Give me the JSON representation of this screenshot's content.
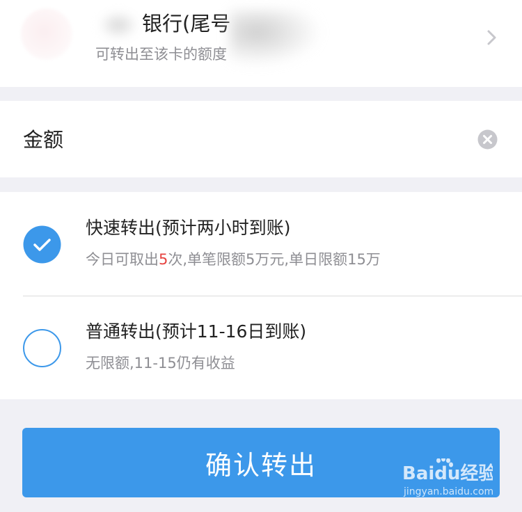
{
  "card": {
    "bank_name": "银行(尾号",
    "limit_text": "可转出至该卡的额度"
  },
  "amount": {
    "label": "金额",
    "value": ""
  },
  "options": [
    {
      "title": "快速转出(预计两小时到账)",
      "desc_pre": "今日可取出",
      "desc_highlight": "5",
      "desc_post": "次,单笔限额5万元,单日限额15万",
      "selected": true
    },
    {
      "title": "普通转出(预计11-16日到账)",
      "desc": "无限额,11-15仍有收益",
      "selected": false
    }
  ],
  "confirm": {
    "label": "确认转出"
  },
  "watermark": {
    "brand": "Baidu经验",
    "url": "jingyan.baidu.com"
  },
  "colors": {
    "accent": "#3c98ea",
    "highlight": "#e64340",
    "background": "#f0f0f5",
    "secondary_text": "#8e8e93"
  },
  "icons": {
    "card_row": "chevron-right-icon",
    "amount_row": "clear-icon",
    "selected_option": "checkmark-icon"
  }
}
